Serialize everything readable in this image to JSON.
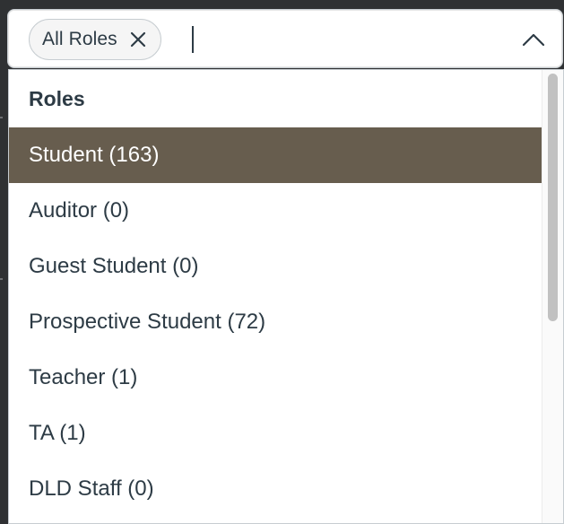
{
  "colors": {
    "highlight_bg": "#675d4e",
    "text": "#2d3b45",
    "border": "#c7cdd1"
  },
  "select": {
    "selected_chip": {
      "label": "All Roles",
      "remove_icon": "close-icon"
    },
    "input_value": "",
    "toggle_icon": "chevron-up-icon"
  },
  "dropdown": {
    "group_label": "Roles",
    "options": [
      {
        "label": "Student (163)",
        "highlighted": true
      },
      {
        "label": "Auditor (0)",
        "highlighted": false
      },
      {
        "label": "Guest Student (0)",
        "highlighted": false
      },
      {
        "label": "Prospective Student (72)",
        "highlighted": false
      },
      {
        "label": "Teacher (1)",
        "highlighted": false
      },
      {
        "label": "TA (1)",
        "highlighted": false
      },
      {
        "label": "DLD Staff (0)",
        "highlighted": false
      }
    ]
  }
}
